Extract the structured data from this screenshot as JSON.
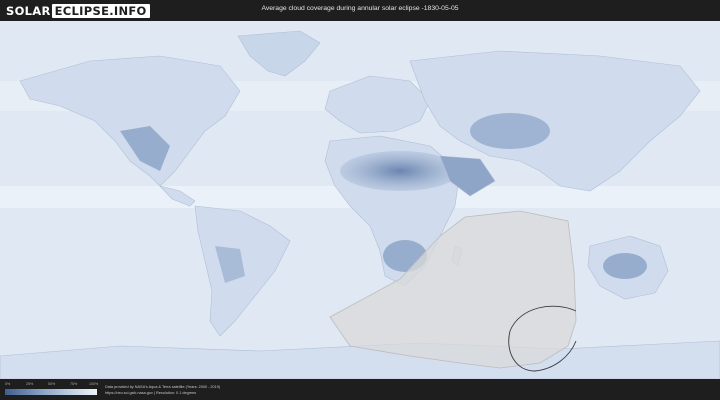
{
  "header": {
    "logo_solar": "SOLAR",
    "logo_site": "ECLIPSE.INFO",
    "title": "Average cloud coverage during annular solar eclipse -1830-05-05"
  },
  "map": {
    "ocean_color": "#dfe8f3",
    "land_color": "#d0dced",
    "cloudfree_color": "#5f7ba8",
    "eclipse_region_color": "#d9d9d9",
    "eclipse_outline_color": "#3a3a3a"
  },
  "legend": {
    "ticks": [
      "0%",
      "25%",
      "50%",
      "75%",
      "100%"
    ],
    "gradient": [
      "#3e5f8e",
      "#7d98bf",
      "#b8c9df",
      "#eef3f9"
    ]
  },
  "footer": {
    "credit_line_1": "Data provided by NASA's Aqua & Terra satellite (Years: 2000 - 2019)",
    "credit_line_2": "https://neo.sci.gsfc.nasa.gov | Resolution: 0.1 degrees"
  }
}
